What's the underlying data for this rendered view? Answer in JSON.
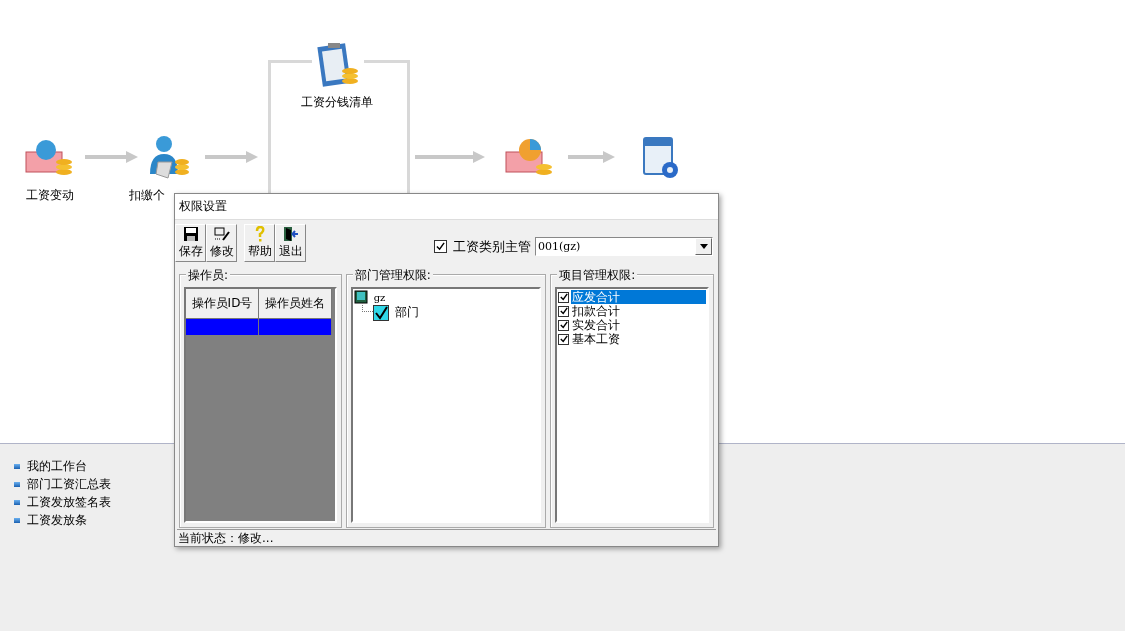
{
  "flow": {
    "nodes": [
      {
        "kind": "change",
        "label": "工资变动"
      },
      {
        "kind": "tax",
        "label": "扣缴个"
      },
      {
        "kind": "list",
        "label": "工资分钱清单"
      },
      {
        "kind": "allocate"
      },
      {
        "kind": "log"
      }
    ]
  },
  "links": [
    "我的工作台",
    "部门工资汇总表",
    "工资发放签名表",
    "工资发放条"
  ],
  "dialog": {
    "title": "权限设置",
    "toolbar": [
      {
        "kind": "save",
        "label": "保存"
      },
      {
        "kind": "edit",
        "label": "修改"
      },
      {
        "kind": "help",
        "label": "帮助"
      },
      {
        "kind": "exit",
        "label": "退出"
      }
    ],
    "supervisor": {
      "label": "工资类别主管",
      "checked": true
    },
    "category": {
      "value": "001(gz)"
    },
    "operators": {
      "title": "操作员:",
      "columns": [
        "操作员ID号",
        "操作员姓名"
      ],
      "rows": [
        {
          "selected": true
        }
      ]
    },
    "departments": {
      "title": "部门管理权限:",
      "tree": [
        {
          "label": "gz",
          "children": [
            {
              "label": "部门",
              "checked": true
            }
          ]
        }
      ]
    },
    "items": {
      "title": "项目管理权限:",
      "list": [
        {
          "label": "应发合计",
          "checked": true,
          "selected": true
        },
        {
          "label": "扣款合计",
          "checked": true,
          "selected": false
        },
        {
          "label": "实发合计",
          "checked": true,
          "selected": false
        },
        {
          "label": "基本工资",
          "checked": true,
          "selected": false
        }
      ]
    },
    "status": "当前状态：修改..."
  }
}
